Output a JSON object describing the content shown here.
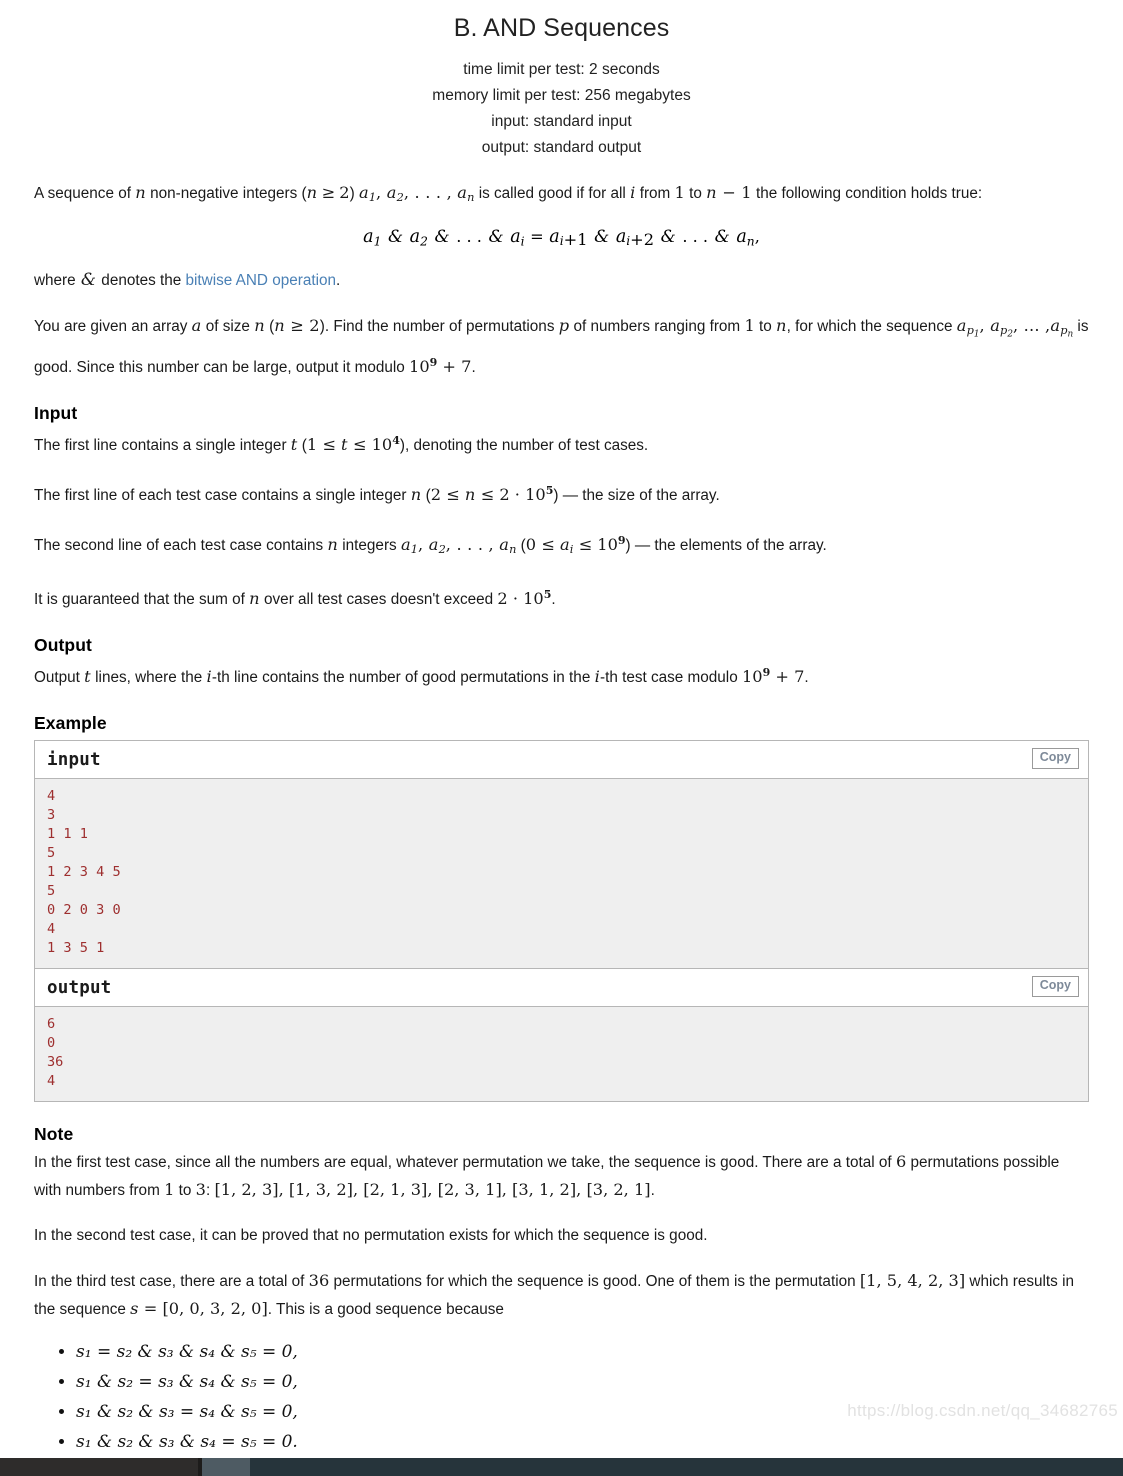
{
  "problem": {
    "title": "B. AND Sequences",
    "time_limit": "time limit per test: 2 seconds",
    "memory_limit": "memory limit per test: 256 megabytes",
    "input_spec": "input: standard input",
    "output_spec": "output: standard output"
  },
  "statement": {
    "p1_a": "A sequence of ",
    "p1_n": "n",
    "p1_b": " non-negative integers (",
    "p1_c": "n",
    "p1_ge": "≥",
    "p1_two": "2",
    "p1_d": ") ",
    "p1_seq": "a",
    "p1_e": " is called good if for all ",
    "p1_i": "i",
    "p1_f": " from ",
    "p1_one": "1",
    "p1_g": " to ",
    "p1_nm1": "n − 1",
    "p1_h": " the following condition holds true:",
    "formula": "a₁ & a₂ & … & aᵢ = aᵢ₊₁ & aᵢ₊₂ & … & aₙ,",
    "p2_a": "where ",
    "p2_amp": "&",
    "p2_b": " denotes the ",
    "p2_link": "bitwise AND operation",
    "p2_c": ".",
    "p3_a": "You are given an array ",
    "p3_arr": "a",
    "p3_b": " of size ",
    "p3_n": "n",
    "p3_c": " (",
    "p3_d": ")",
    "p3_e": ". Find the number of permutations ",
    "p3_p": "p",
    "p3_f": " of numbers ranging from ",
    "p3_g": " to ",
    "p3_h": ", for which the sequence ",
    "p3_i": " is good. Since this number can be large, output it modulo ",
    "p3_mod": "10⁹ + 7",
    "p3_j": "."
  },
  "input_section": {
    "heading": "Input",
    "line1_a": "The first line contains a single integer ",
    "line1_t": "t",
    "line1_b": " (",
    "line1_range": "1 ≤ t ≤ 10⁴",
    "line1_c": "), denoting the number of test cases.",
    "line2_a": "The first line of each test case contains a single integer ",
    "line2_n": "n",
    "line2_b": " (",
    "line2_range": "2 ≤ n ≤ 2 · 10⁵",
    "line2_c": ") — the size of the array.",
    "line3_a": "The second line of each test case contains ",
    "line3_n": "n",
    "line3_b": " integers ",
    "line3_seq": "a₁, a₂, …, aₙ",
    "line3_c": " (",
    "line3_range": "0 ≤ aᵢ ≤ 10⁹",
    "line3_d": ") — the elements of the array.",
    "line4_a": "It is guaranteed that the sum of ",
    "line4_n": "n",
    "line4_b": " over all test cases doesn't exceed ",
    "line4_val": "2 · 10⁵",
    "line4_c": "."
  },
  "output_section": {
    "heading": "Output",
    "line_a": "Output ",
    "line_t": "t",
    "line_b": " lines, where the ",
    "line_i": "i",
    "line_c": "-th line contains the number of good permutations in the ",
    "line_i2": "i",
    "line_d": "-th test case modulo ",
    "line_mod": "10⁹ + 7",
    "line_e": "."
  },
  "example": {
    "heading": "Example",
    "input_label": "input",
    "output_label": "output",
    "copy_label": "Copy",
    "input_lines": [
      "4",
      "3",
      "1 1 1",
      "5",
      "1 2 3 4 5",
      "5",
      "0 2 0 3 0",
      "4",
      "1 3 5 1"
    ],
    "output_lines": [
      "6",
      "0",
      "36",
      "4"
    ]
  },
  "note": {
    "heading": "Note",
    "n1_a": "In the first test case, since all the numbers are equal, whatever permutation we take, the sequence is good. There are a total of ",
    "n1_six": "6",
    "n1_b": " permutations possible with numbers from ",
    "n1_one": "1",
    "n1_c": " to ",
    "n1_three": "3",
    "n1_d": ": ",
    "n1_perms": "[1, 2, 3], [1, 3, 2], [2, 1, 3], [2, 3, 1], [3, 1, 2], [3, 2, 1]",
    "n1_e": ".",
    "n2": "In the second test case, it can be proved that no permutation exists for which the sequence is good.",
    "n3_a": "In the third test case, there are a total of ",
    "n3_36": "36",
    "n3_b": " permutations for which the sequence is good. One of them is the permutation ",
    "n3_perm": "[1, 5, 4, 2, 3]",
    "n3_c": " which results in the sequence ",
    "n3_s": "s",
    "n3_eq": " = ",
    "n3_seq": "[0, 0, 3, 2, 0]",
    "n3_d": ". This is a good sequence because",
    "bullets": [
      "s₁ = s₂ & s₃ & s₄ & s₅ = 0,",
      "s₁ & s₂ = s₃ & s₄ & s₅ = 0,",
      "s₁ & s₂ & s₃ = s₄ & s₅ = 0,",
      "s₁ & s₂ & s₃ & s₄ = s₅ = 0."
    ]
  },
  "watermark": {
    "text": "https://blog.csdn.net/qq_34682765"
  },
  "colors": {
    "link": "#4a80b5",
    "code_text": "#9e2f2f",
    "code_bg": "#efefef",
    "border": "#b6b6b6",
    "copy_text": "#7e8a99"
  }
}
